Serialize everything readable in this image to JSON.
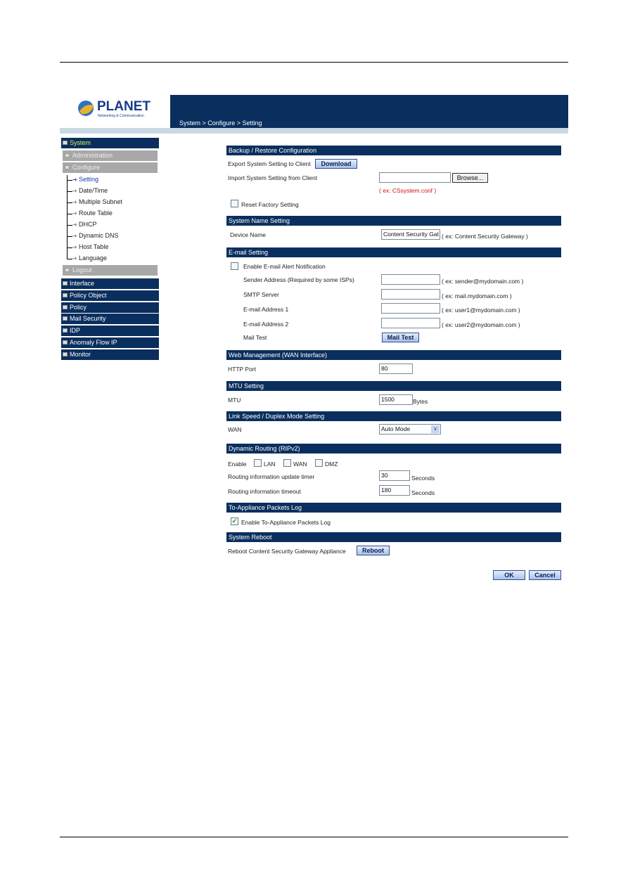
{
  "header": {
    "logo_text": "PLANET",
    "logo_tagline": "Networking & Communication",
    "breadcrumb": "System > Configure > Setting"
  },
  "sidebar": {
    "system": "System",
    "administration": "Administration",
    "configure": "Configure",
    "configure_items": [
      "Setting",
      "Date/Time",
      "Multiple Subnet",
      "Route Table",
      "DHCP",
      "Dynamic DNS",
      "Host Table",
      "Language"
    ],
    "logout": "Logout",
    "menus": [
      "Interface",
      "Policy Object",
      "Policy",
      "Mail Security",
      "IDP",
      "Anomaly Flow IP",
      "Monitor"
    ]
  },
  "backup": {
    "title": "Backup / Restore Configuration",
    "export_label": "Export System Setting to Client",
    "download": "Download",
    "import_label": "Import System Setting from Client",
    "import_value": "",
    "browse": "Browse...",
    "import_hint": "( ex: CSsystem.conf )",
    "reset_label": "Reset Factory Setting",
    "reset_checked": false
  },
  "sysname": {
    "title": "System Name Setting",
    "device_label": "Device Name",
    "device_value": "Content Security Gat",
    "device_hint": "( ex: Content Security Gateway )"
  },
  "email": {
    "title": "E-mail Setting",
    "enable_label": "Enable E-mail Alert Notification",
    "enable_checked": false,
    "sender_label": "Sender Address  (Required by some ISPs)",
    "sender_hint": "( ex: sender@mydomain.com )",
    "smtp_label": "SMTP Server",
    "smtp_hint": "( ex: mail.mydomain.com )",
    "addr1_label": "E-mail Address 1",
    "addr1_hint": "( ex: user1@mydomain.com )",
    "addr2_label": "E-mail Address 2",
    "addr2_hint": "( ex: user2@mydomain.com )",
    "mailtest_label": "Mail Test",
    "mailtest_button": "Mail Test"
  },
  "web": {
    "title": "Web Management (WAN Interface)",
    "port_label": "HTTP Port",
    "port_value": "80"
  },
  "mtu": {
    "title": "MTU Setting",
    "label": "MTU",
    "value": "1500",
    "unit": "Bytes"
  },
  "link": {
    "title": "Link Speed / Duplex Mode Setting",
    "wan_label": "WAN",
    "wan_value": "Auto Mode"
  },
  "rip": {
    "title": "Dynamic Routing (RIPv2)",
    "enable_label": "Enable",
    "lan": "LAN",
    "wan": "WAN",
    "dmz": "DMZ",
    "update_label": "Routing information update timer",
    "update_value": "30",
    "timeout_label": "Routing information timeout",
    "timeout_value": "180",
    "unit": "Seconds"
  },
  "pktlog": {
    "title": "To-Appliance Packets Log",
    "enable_label": "Enable To-Appliance Packets Log",
    "enable_checked": true
  },
  "reboot": {
    "title": "System Reboot",
    "label": "Reboot Content Security Gateway Appliance",
    "button": "Reboot"
  },
  "actions": {
    "ok": "OK",
    "cancel": "Cancel"
  },
  "colors": {
    "navy": "#0a2f5e",
    "menu_grey": "#a8a8a8",
    "active_item": "#1a3aa8",
    "hint_red": "#d01010"
  }
}
